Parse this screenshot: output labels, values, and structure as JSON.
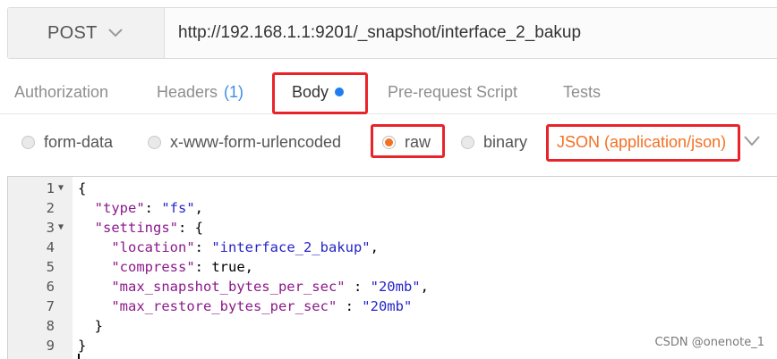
{
  "request": {
    "method": "POST",
    "url": "http://192.168.1.1:9201/_snapshot/interface_2_bakup"
  },
  "tabs": {
    "authorization": "Authorization",
    "headers": "Headers",
    "headers_count": "(1)",
    "body": "Body",
    "pre_request": "Pre-request Script",
    "tests": "Tests"
  },
  "body_modes": {
    "form_data": "form-data",
    "urlencoded": "x-www-form-urlencoded",
    "raw": "raw",
    "binary": "binary",
    "selected": "raw",
    "format": "JSON (application/json)"
  },
  "editor": {
    "line_numbers": [
      "1",
      "2",
      "3",
      "4",
      "5",
      "6",
      "7",
      "8",
      "9"
    ],
    "lines": [
      "{",
      "  \"type\": \"fs\",",
      "  \"settings\": {",
      "    \"location\": \"interface_2_bakup\",",
      "    \"compress\": true,",
      "    \"max_snapshot_bytes_per_sec\" : \"20mb\",",
      "    \"max_restore_bytes_per_sec\" : \"20mb\"",
      "  }",
      "}"
    ]
  },
  "watermark": "CSDN @onenote_1",
  "colors": {
    "accent": "#f47023",
    "highlight_box": "#e8242a",
    "json_key": "#8b1a8b",
    "json_string": "#2525c8",
    "unsaved_dot": "#1f7df0"
  }
}
